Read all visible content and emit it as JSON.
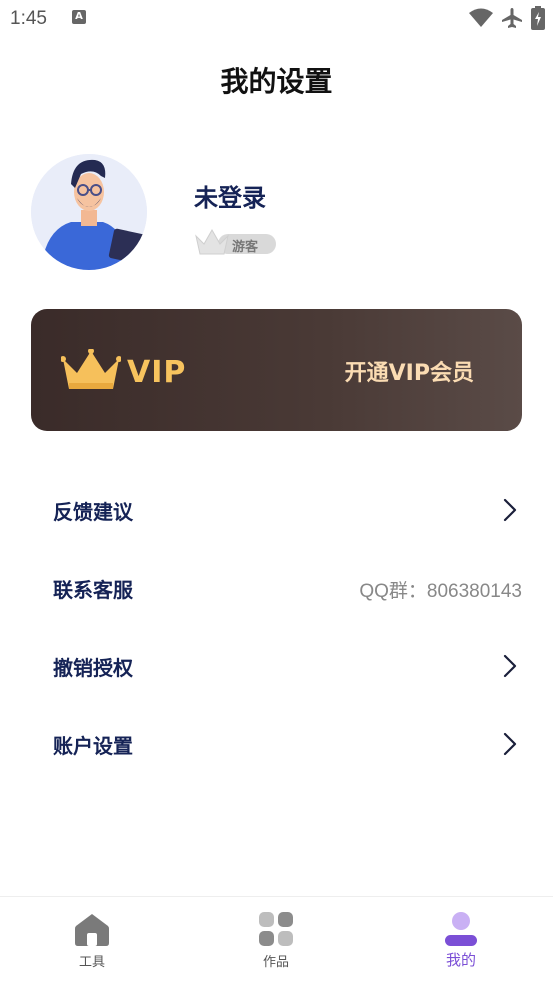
{
  "status_bar": {
    "time": "1:45",
    "notification_icon": "a-icon",
    "icons": [
      "wifi-icon",
      "airplane-icon",
      "battery-charging-icon"
    ]
  },
  "header": {
    "title": "我的设置"
  },
  "profile": {
    "name": "未登录",
    "badge": "游客",
    "avatar_icon": "user-avatar-illustration"
  },
  "vip": {
    "logo_text": "VIP",
    "action_label": "开通VIP会员",
    "accent_color": "#f7c35e"
  },
  "menu": {
    "feedback": {
      "label": "反馈建议"
    },
    "contact": {
      "label": "联系客服",
      "value": "QQ群：806380143"
    },
    "revoke": {
      "label": "撤销授权"
    },
    "account": {
      "label": "账户设置"
    }
  },
  "bottom_nav": {
    "tools": {
      "label": "工具",
      "icon": "home-icon"
    },
    "works": {
      "label": "作品",
      "icon": "grid-icon"
    },
    "mine": {
      "label": "我的",
      "icon": "person-icon",
      "active": true,
      "active_color": "#7b4fd6"
    }
  }
}
